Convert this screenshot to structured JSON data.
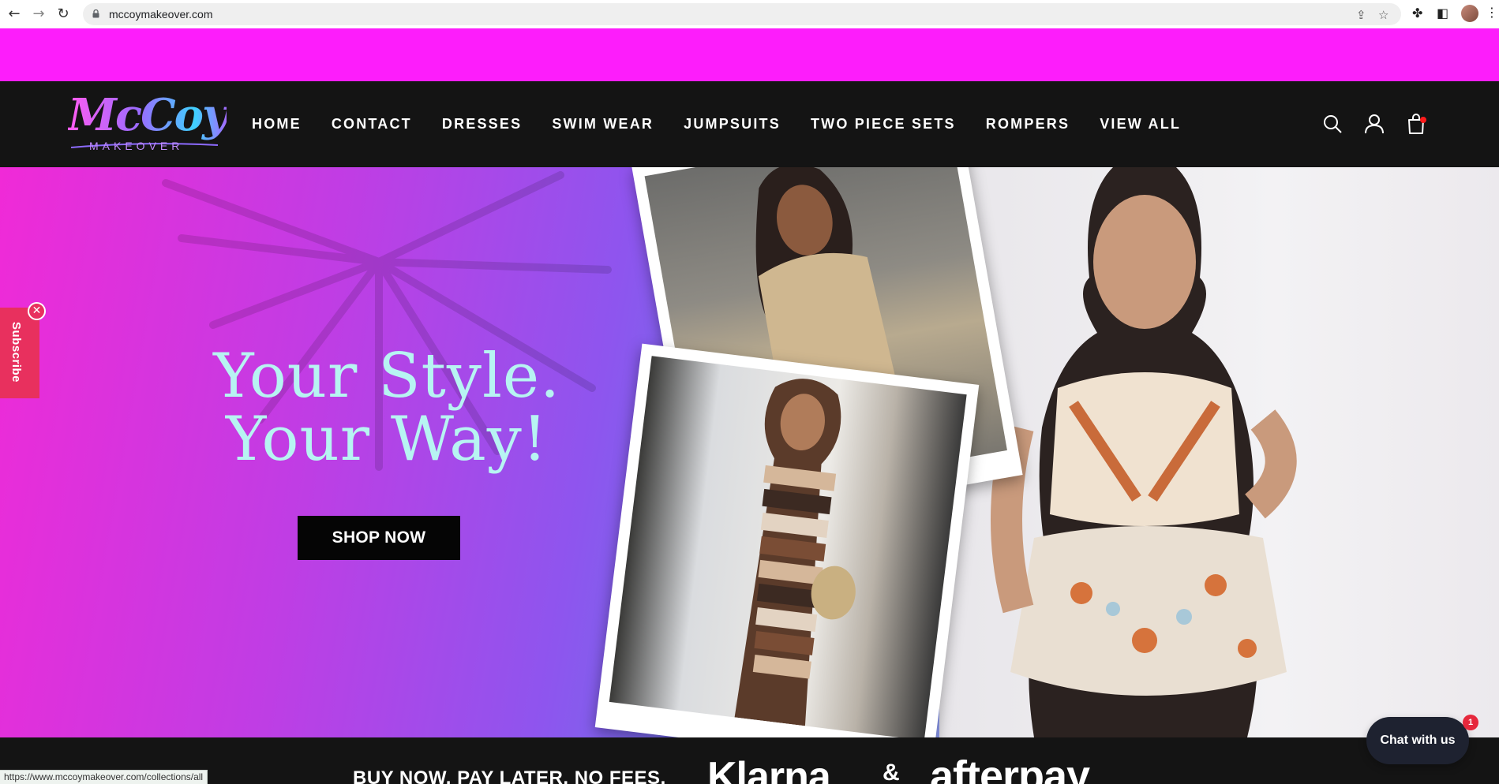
{
  "browser": {
    "url": "mccoymakeover.com",
    "status_url": "https://www.mccoymakeover.com/collections/all",
    "icons": [
      "back-icon",
      "forward-icon",
      "reload-icon",
      "lock-icon",
      "share-icon",
      "star-icon",
      "extensions-icon",
      "tab-search-icon",
      "profile-avatar",
      "more-menu-icon"
    ]
  },
  "brand": {
    "logo_script": "McCoy",
    "logo_sub": "MAKEOVER",
    "colors": {
      "announcement": "#fd1dfb",
      "header": "#141414",
      "headline": "#b7f4f2",
      "subscribe": "#e8305e",
      "chat": "#1e2230"
    }
  },
  "nav": {
    "items": [
      {
        "label": "HOME"
      },
      {
        "label": "CONTACT"
      },
      {
        "label": "DRESSES"
      },
      {
        "label": "SWIM WEAR"
      },
      {
        "label": "JUMPSUITS"
      },
      {
        "label": "TWO PIECE SETS"
      },
      {
        "label": "ROMPERS"
      },
      {
        "label": "VIEW ALL"
      }
    ],
    "icons": [
      "search-icon",
      "account-icon",
      "cart-icon"
    ]
  },
  "hero": {
    "headline_line1": "Your Style.",
    "headline_line2": "Your Way!",
    "cta": "SHOP NOW"
  },
  "subscribe": {
    "label": "Subscribe",
    "close": "✕"
  },
  "bnpl": {
    "text": "BUY NOW, PAY LATER, NO FEES.",
    "klarna": "Klarna.",
    "amp": "&",
    "afterpay": "afterpay"
  },
  "chat": {
    "label": "Chat with us",
    "badge": "1"
  }
}
